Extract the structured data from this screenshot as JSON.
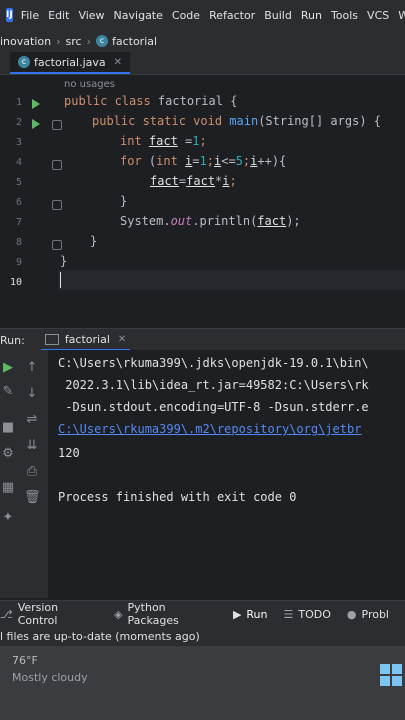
{
  "menubar": {
    "items": [
      "File",
      "Edit",
      "View",
      "Navigate",
      "Code",
      "Refactor",
      "Build",
      "Run",
      "Tools",
      "VCS",
      "W"
    ]
  },
  "breadcrumb": {
    "items": [
      "inovation",
      "src",
      "factorial"
    ]
  },
  "editor": {
    "tab_label": "factorial.java",
    "usages_hint": "no usages",
    "line_numbers": [
      "1",
      "2",
      "3",
      "4",
      "5",
      "6",
      "7",
      "8",
      "9",
      "10"
    ],
    "code": {
      "l1_kw": "public class ",
      "l1_name": "factorial ",
      "l1_brace": "{",
      "l2_kw": "public static void ",
      "l2_fn": "main",
      "l2_rest": "(String[] args) {",
      "l3_kw": "int ",
      "l3_var": "fact",
      "l3_eq": " =",
      "l3_num": "1",
      "l3_end": ";",
      "l4_kw": "for ",
      "l4_open": "(",
      "l4_kw2": "int ",
      "l4_i1": "i",
      "l4_eq": "=",
      "l4_n1": "1",
      "l4_semi1": ";",
      "l4_i2": "i",
      "l4_le": "<=",
      "l4_n2": "5",
      "l4_semi2": ";",
      "l4_i3": "i",
      "l4_inc": "++){",
      "l5_v1": "fact",
      "l5_eq": "=",
      "l5_v2": "fact",
      "l5_mul": "*",
      "l5_v3": "i",
      "l5_end": ";",
      "l6": "}",
      "l7_a": "System.",
      "l7_out": "out",
      "l7_b": ".println(",
      "l7_var": "fact",
      "l7_c": ");",
      "l8": "}",
      "l9": "}"
    }
  },
  "run_panel": {
    "label": "Run:",
    "tab_label": "factorial",
    "console_lines": [
      "C:\\Users\\rkuma399\\.jdks\\openjdk-19.0.1\\bin\\",
      " 2022.3.1\\lib\\idea_rt.jar=49582:C:\\Users\\rk",
      " -Dsun.stdout.encoding=UTF-8 -Dsun.stderr.e",
      "C:\\Users\\rkuma399\\.m2\\repository\\org\\jetbr",
      "120",
      "",
      "Process finished with exit code 0"
    ]
  },
  "bottom_tools": {
    "items": [
      "Version Control",
      "Python Packages",
      "Run",
      "TODO",
      "Probl"
    ]
  },
  "statusbar": {
    "text": "l files are up-to-date (moments ago)"
  },
  "taskbar": {
    "weather_temp": "76°F",
    "weather_desc": "Mostly cloudy"
  },
  "colors": {
    "accent": "#3574f0",
    "keyword": "#cf8e6d",
    "function": "#56a8f5",
    "number": "#2aacb8",
    "run_green": "#5fb865"
  }
}
